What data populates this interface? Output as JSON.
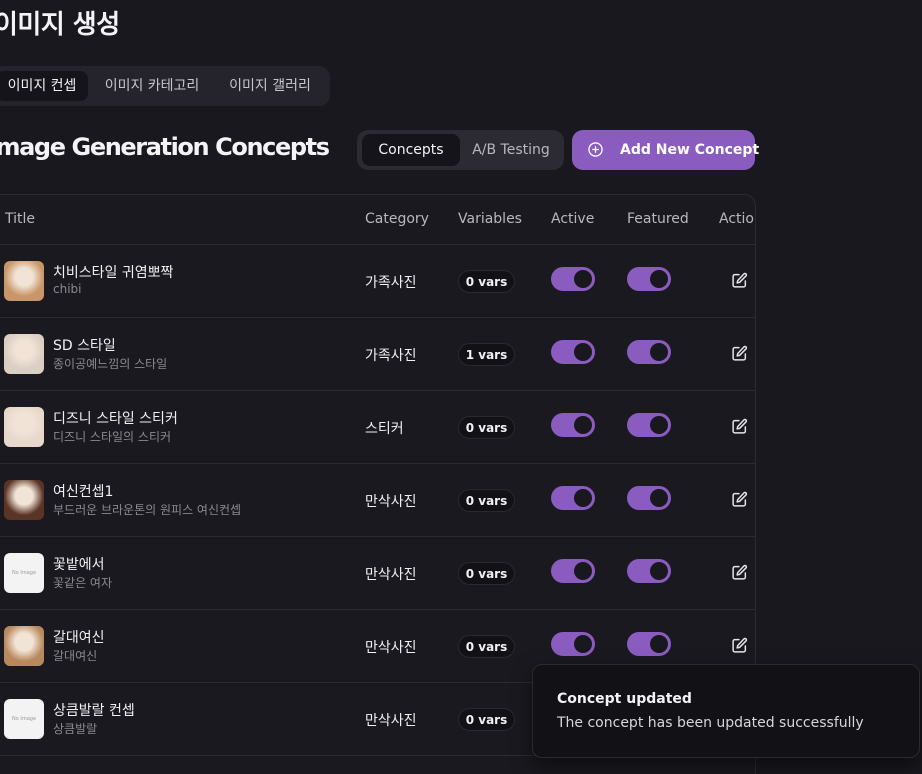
{
  "page": {
    "title": "이미지 생성",
    "section_title": "Image Generation Concepts"
  },
  "top_tabs": [
    {
      "label": "이미지 컨셉",
      "active": true
    },
    {
      "label": "이미지 카테고리",
      "active": false
    },
    {
      "label": "이미지 갤러리",
      "active": false
    }
  ],
  "view_toggle": [
    {
      "label": "Concepts",
      "active": true
    },
    {
      "label": "A/B Testing",
      "active": false
    }
  ],
  "add_button": {
    "label": "Add New Concept",
    "icon": "plus-circle-icon"
  },
  "table": {
    "headers": {
      "title": "Title",
      "category": "Category",
      "variables": "Variables",
      "active": "Active",
      "featured": "Featured",
      "actions": "Actions"
    },
    "rows": [
      {
        "title": "치비스타일 귀염뽀짝",
        "subtitle": "chibi",
        "category": "가족사진",
        "vars": "0 vars",
        "active": true,
        "featured": true,
        "thumb": "image",
        "thumb_color": "#c99667"
      },
      {
        "title": "SD 스타일",
        "subtitle": "종이공예느낌의 스타일",
        "category": "가족사진",
        "vars": "1 vars",
        "active": true,
        "featured": true,
        "thumb": "image",
        "thumb_color": "#d9cfc3"
      },
      {
        "title": "디즈니 스타일 스티커",
        "subtitle": "디즈니 스타일의 스티커",
        "category": "스티커",
        "vars": "0 vars",
        "active": true,
        "featured": true,
        "thumb": "image",
        "thumb_color": "#e8d8cc"
      },
      {
        "title": "여신컨셉1",
        "subtitle": "부드러운 브라운톤의 원피스 여신컨셉",
        "category": "만삭사진",
        "vars": "0 vars",
        "active": true,
        "featured": true,
        "thumb": "image",
        "thumb_color": "#5a3424"
      },
      {
        "title": "꽃밭에서",
        "subtitle": "꽃같은 여자",
        "category": "만삭사진",
        "vars": "0 vars",
        "active": true,
        "featured": true,
        "thumb": "none",
        "thumb_label": "No Image"
      },
      {
        "title": "갈대여신",
        "subtitle": "갈대여신",
        "category": "만삭사진",
        "vars": "0 vars",
        "active": true,
        "featured": true,
        "thumb": "image",
        "thumb_color": "#b8895e"
      },
      {
        "title": "상큼발랄 컨셉",
        "subtitle": "상큼발랄",
        "category": "만삭사진",
        "vars": "0 vars",
        "active": true,
        "featured": true,
        "thumb": "none",
        "thumb_label": "No Image"
      }
    ]
  },
  "toast": {
    "title": "Concept updated",
    "message": "The concept has been updated successfully"
  },
  "colors": {
    "accent": "#8a5cc0",
    "background": "#19181e"
  }
}
